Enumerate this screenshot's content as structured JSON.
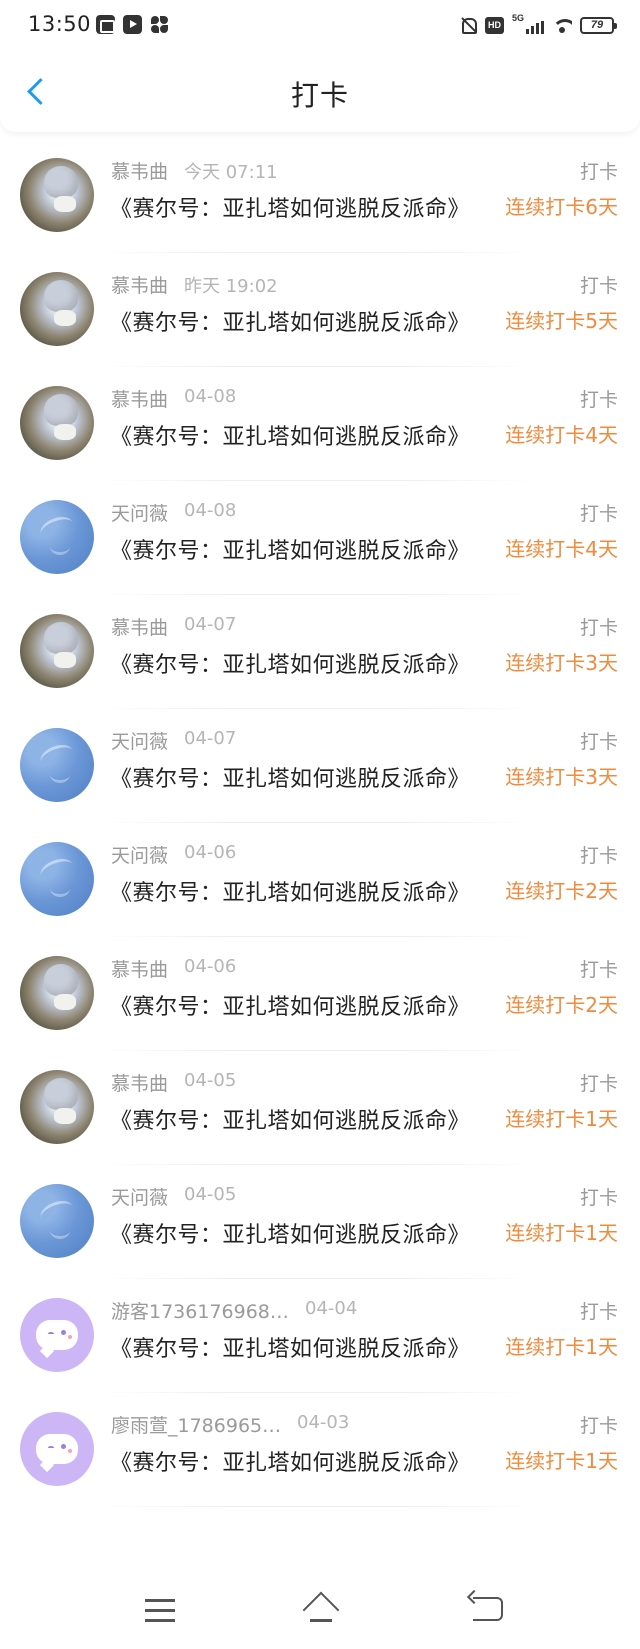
{
  "status_bar": {
    "time": "13:50",
    "left_icons": [
      "screen-share-icon",
      "play-icon",
      "pinwheel-icon"
    ],
    "right_icons": [
      "mute-bell-icon",
      "hd-icon",
      "5g-signal-icon",
      "wifi-icon",
      "battery-icon"
    ],
    "hd_label": "HD",
    "network_label": "5G",
    "battery_level": "79"
  },
  "header": {
    "back_icon": "chevron-left-icon",
    "title": "打卡"
  },
  "colors": {
    "back_accent": "#1a9bf0",
    "streak_text": "#f08a3c",
    "guest_avatar": "#cdb6f6"
  },
  "checkins": [
    {
      "avatar": "cat-photo",
      "name": "慕韦曲",
      "time": "今天 07:11",
      "action": "打卡",
      "book": "《赛尔号：亚扎塔如何逃脱反派命》",
      "streak": "连续打卡6天"
    },
    {
      "avatar": "cat-photo",
      "name": "慕韦曲",
      "time": "昨天 19:02",
      "action": "打卡",
      "book": "《赛尔号：亚扎塔如何逃脱反派命》",
      "streak": "连续打卡5天"
    },
    {
      "avatar": "cat-photo",
      "name": "慕韦曲",
      "time": "04-08",
      "action": "打卡",
      "book": "《赛尔号：亚扎塔如何逃脱反派命》",
      "streak": "连续打卡4天"
    },
    {
      "avatar": "sky-photo",
      "name": "天问薇",
      "time": "04-08",
      "action": "打卡",
      "book": "《赛尔号：亚扎塔如何逃脱反派命》",
      "streak": "连续打卡4天"
    },
    {
      "avatar": "cat-photo",
      "name": "慕韦曲",
      "time": "04-07",
      "action": "打卡",
      "book": "《赛尔号：亚扎塔如何逃脱反派命》",
      "streak": "连续打卡3天"
    },
    {
      "avatar": "sky-photo",
      "name": "天问薇",
      "time": "04-07",
      "action": "打卡",
      "book": "《赛尔号：亚扎塔如何逃脱反派命》",
      "streak": "连续打卡3天"
    },
    {
      "avatar": "sky-photo",
      "name": "天问薇",
      "time": "04-06",
      "action": "打卡",
      "book": "《赛尔号：亚扎塔如何逃脱反派命》",
      "streak": "连续打卡2天"
    },
    {
      "avatar": "cat-photo",
      "name": "慕韦曲",
      "time": "04-06",
      "action": "打卡",
      "book": "《赛尔号：亚扎塔如何逃脱反派命》",
      "streak": "连续打卡2天"
    },
    {
      "avatar": "cat-photo",
      "name": "慕韦曲",
      "time": "04-05",
      "action": "打卡",
      "book": "《赛尔号：亚扎塔如何逃脱反派命》",
      "streak": "连续打卡1天"
    },
    {
      "avatar": "sky-photo",
      "name": "天问薇",
      "time": "04-05",
      "action": "打卡",
      "book": "《赛尔号：亚扎塔如何逃脱反派命》",
      "streak": "连续打卡1天"
    },
    {
      "avatar": "guest-chat",
      "name": "游客1736176968…",
      "time": "04-04",
      "action": "打卡",
      "book": "《赛尔号：亚扎塔如何逃脱反派命》",
      "streak": "连续打卡1天"
    },
    {
      "avatar": "guest-chat",
      "name": "廖雨萱_1786965…",
      "time": "04-03",
      "action": "打卡",
      "book": "《赛尔号：亚扎塔如何逃脱反派命》",
      "streak": "连续打卡1天"
    }
  ],
  "nav_bar": {
    "icons": [
      "menu-icon",
      "home-icon",
      "back-icon"
    ]
  }
}
